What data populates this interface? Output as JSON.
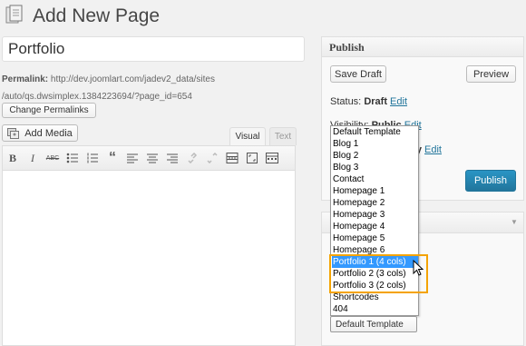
{
  "header": {
    "title": "Add New Page",
    "icon": "pages-icon"
  },
  "title_field": {
    "value": "Portfolio"
  },
  "permalink": {
    "label": "Permalink:",
    "url_line1": "http://dev.joomlart.com/jadev2_data/sites",
    "url_line2": "/auto/qs.dwsimplex.1384223694/?page_id=654",
    "change_label": "Change Permalinks"
  },
  "media": {
    "add_label": "Add Media"
  },
  "editor": {
    "tabs": [
      {
        "label": "Visual"
      },
      {
        "label": "Text"
      }
    ],
    "toolbar_icons": [
      "bold-icon",
      "italic-icon",
      "strikethrough-icon",
      "bullet-list-icon",
      "numbered-list-icon",
      "blockquote-icon",
      "align-left-icon",
      "align-center-icon",
      "align-right-icon",
      "link-icon",
      "unlink-icon",
      "more-tag-icon",
      "fullscreen-icon",
      "kitchen-sink-icon"
    ],
    "toolbar_glyphs": {
      "bold": "B",
      "italic": "I",
      "strike": "ABC",
      "blockquote": "“"
    }
  },
  "publish": {
    "title": "Publish",
    "save_draft_label": "Save Draft",
    "preview_label": "Preview",
    "status_label": "Status:",
    "status_value": "Draft",
    "edit_label": "Edit",
    "visibility_label": "Visibility:",
    "visibility_value": "Public",
    "immediately_text": "tely",
    "publish_label": "Publish"
  },
  "template_select": {
    "selected": "Default Template",
    "highlighted": "Portfolio 1 (4 cols)",
    "options": [
      "Default Template",
      "Blog 1",
      "Blog 2",
      "Blog 3",
      "Contact",
      "Homepage 1",
      "Homepage 2",
      "Homepage 3",
      "Homepage 4",
      "Homepage 5",
      "Homepage 6",
      "Portfolio 1 (4 cols)",
      "Portfolio 2 (3 cols)",
      "Portfolio 3 (2 cols)",
      "Shortcodes",
      "404"
    ]
  },
  "colors": {
    "accent": "#21759b",
    "highlight_border": "#f4a300",
    "selected_option": "#3399ff"
  }
}
